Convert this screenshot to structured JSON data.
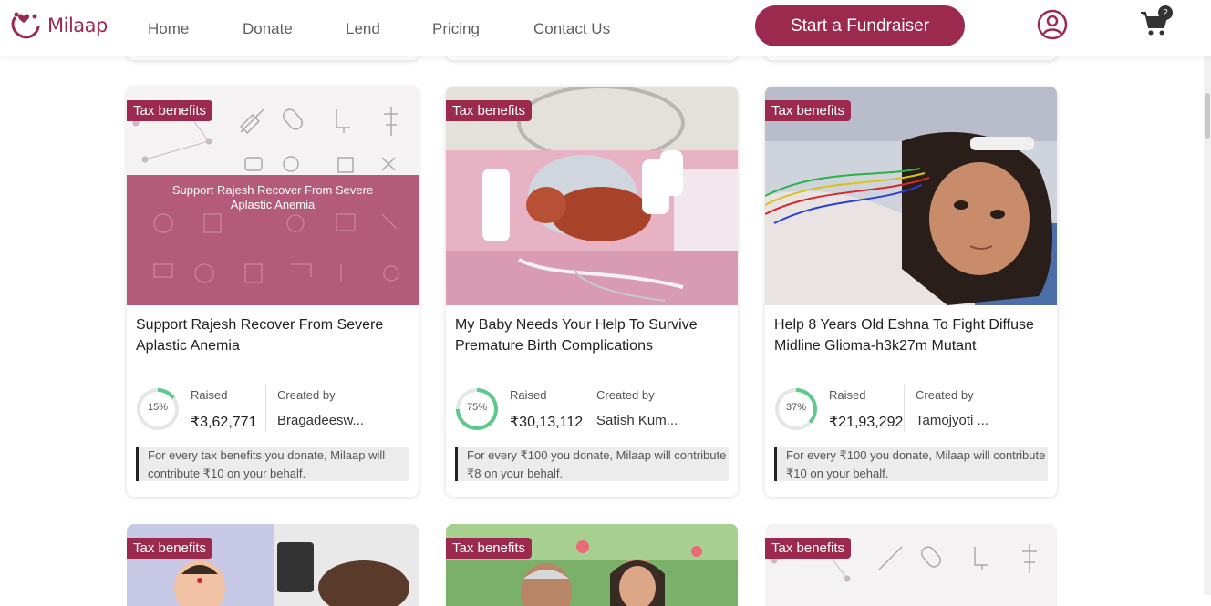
{
  "header": {
    "logo_text": "Milaap",
    "nav": [
      "Home",
      "Donate",
      "Lend",
      "Pricing",
      "Contact Us"
    ],
    "cta_label": "Start a Fundraiser",
    "cart_count": "2",
    "brand_color": "#9c2a4f"
  },
  "cards": [
    {
      "badge": "Tax benefits",
      "banner_text": "Support Rajesh Recover From Severe Aplastic Anemia",
      "title": "Support Rajesh Recover From Severe Aplastic Anemia",
      "progress_label": "15%",
      "progress": 0.15,
      "raised_label": "Raised",
      "raised_value": "₹3,62,771",
      "created_label": "Created by",
      "created_value": "Bragadeesw...",
      "note": "For every tax benefits you donate, Milaap will contribute ₹10 on your behalf."
    },
    {
      "badge": "Tax benefits",
      "title": "My Baby Needs Your Help To Survive Premature Birth Complications",
      "progress_label": "75%",
      "progress": 0.75,
      "raised_label": "Raised",
      "raised_value": "₹30,13,112",
      "created_label": "Created by",
      "created_value": "Satish Kum...",
      "note": "For every ₹100 you donate, Milaap will contribute ₹8 on your behalf."
    },
    {
      "badge": "Tax benefits",
      "title": "Help 8 Years Old Eshna To Fight Diffuse Midline Glioma-h3k27m Mutant",
      "progress_label": "37%",
      "progress": 0.37,
      "raised_label": "Raised",
      "raised_value": "₹21,93,292",
      "created_label": "Created by",
      "created_value": "Tamojyoti ...",
      "note": "For every ₹100 you donate, Milaap will contribute ₹10 on your behalf."
    }
  ],
  "bottom_cards": [
    {
      "badge": "Tax benefits"
    },
    {
      "badge": "Tax benefits"
    },
    {
      "badge": "Tax benefits"
    }
  ]
}
